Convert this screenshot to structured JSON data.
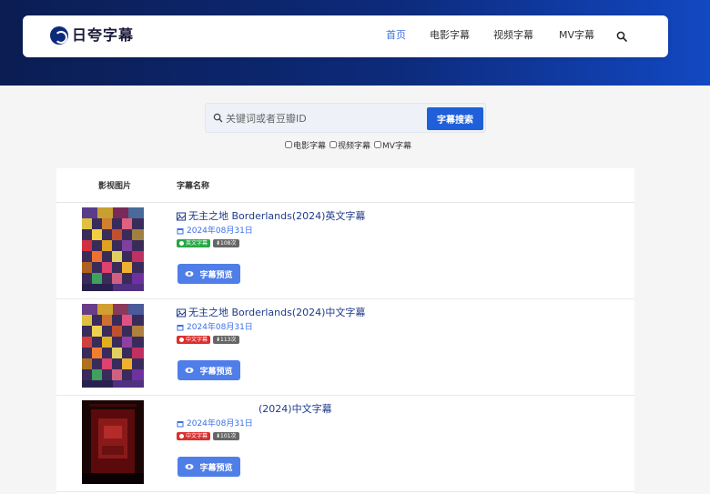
{
  "site": {
    "logo": "日夸字幕"
  },
  "nav": {
    "items": [
      "首页",
      "电影字幕",
      "视频字幕",
      "MV字幕"
    ],
    "active": "首页"
  },
  "search": {
    "placeholder": "关键词或者豆瓣ID",
    "button": "字幕搜索"
  },
  "filters": [
    "电影字幕",
    "视频字幕",
    "MV字幕"
  ],
  "table": {
    "headers": [
      "影视图片",
      "字幕名称"
    ],
    "rows": [
      {
        "title": "无主之地 Borderlands(2024)英文字幕",
        "date": "2024年08月31日",
        "lang": "英文字幕",
        "lang_color": "#28a745",
        "downloads": "108次",
        "button": "字幕预览"
      },
      {
        "title": "无主之地 Borderlands(2024)中文字幕",
        "date": "2024年08月31日",
        "lang": "中文字幕",
        "lang_color": "#d9302f",
        "downloads": "113次",
        "button": "字幕预览"
      },
      {
        "title": "(2024)中文字幕",
        "date": "2024年08月31日",
        "lang": "中文字幕",
        "lang_color": "#d9302f",
        "downloads": "101次",
        "button": "字幕预览"
      }
    ]
  },
  "colors": {
    "accent": "#1f5fd9",
    "header_dark": "#0b1d52",
    "header_light": "#1248c2"
  }
}
